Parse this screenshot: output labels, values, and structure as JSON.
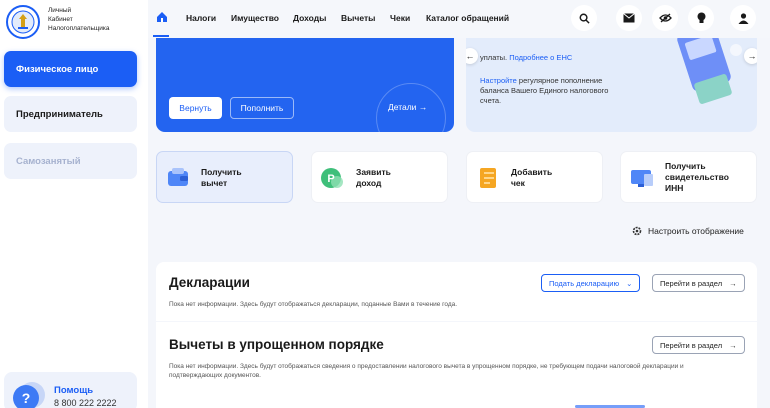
{
  "app": {
    "logo_text": [
      "Личный",
      "Кабинет",
      "Налогоплательщика"
    ]
  },
  "sidebar": {
    "items": [
      {
        "label": "Физическое лицо",
        "state": "active"
      },
      {
        "label": "Предприниматель",
        "state": "normal"
      },
      {
        "label": "Самозанятый",
        "state": "disabled"
      }
    ],
    "help": {
      "title": "Помощь",
      "phone": "8 800 222 2222"
    }
  },
  "nav": {
    "items": [
      "Налоги",
      "Имущество",
      "Доходы",
      "Вычеты",
      "Чеки",
      "Каталог обращений"
    ],
    "icons": [
      "search-icon",
      "mail-icon",
      "eye-off-icon",
      "lightbulb-icon",
      "user-icon"
    ]
  },
  "balance_card": {
    "return_label": "Вернуть",
    "topup_label": "Пополнить",
    "details_label": "Детали"
  },
  "promo_card": {
    "line1_text": "уплаты.",
    "line1_link": "Подробнее о ЕНС",
    "body_link": "Настройте",
    "body_text": "регулярное пополнение баланса Вашего Единого налогового счета."
  },
  "quick_actions": [
    {
      "label_1": "Получить",
      "label_2": "вычет"
    },
    {
      "label_1": "Заявить",
      "label_2": "доход"
    },
    {
      "label_1": "Добавить",
      "label_2": "чек"
    },
    {
      "label_1": "Получить",
      "label_2": "свидетельство",
      "label_3": "ИНН"
    }
  ],
  "settings_label": "Настроить отображение",
  "panels": {
    "declarations": {
      "title": "Декларации",
      "description": "Пока нет информации. Здесь будут отображаться декларации, поданные Вами в течение года.",
      "submit_label": "Подать декларацию",
      "goto_label": "Перейти в раздел"
    },
    "simplified_deductions": {
      "title": "Вычеты в упрощенном порядке",
      "description_1": "Пока нет информации. Здесь будут отображаться сведения о предоставлении налогового вычета в упрощенном порядке, не требующем подачи налоговой декларации и",
      "description_2": "подтверждающих документов.",
      "goto_label": "Перейти в раздел"
    }
  },
  "colors": {
    "accent": "#1b5ef5",
    "background": "#f4f6fb"
  }
}
